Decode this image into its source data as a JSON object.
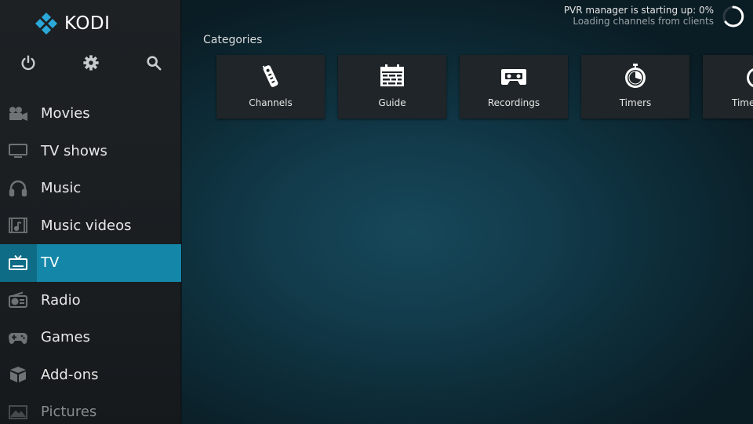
{
  "app": {
    "logo_text": "KODI"
  },
  "sidebar": {
    "top_buttons": [
      {
        "name": "power",
        "icon": "power-icon"
      },
      {
        "name": "settings",
        "icon": "gear-icon"
      },
      {
        "name": "search",
        "icon": "search-icon"
      }
    ],
    "items": [
      {
        "label": "Movies",
        "icon": "movie-camera-icon"
      },
      {
        "label": "TV shows",
        "icon": "monitor-icon"
      },
      {
        "label": "Music",
        "icon": "headphones-icon"
      },
      {
        "label": "Music videos",
        "icon": "music-video-icon"
      },
      {
        "label": "TV",
        "icon": "tv-icon",
        "active": true
      },
      {
        "label": "Radio",
        "icon": "radio-icon"
      },
      {
        "label": "Games",
        "icon": "gamepad-icon"
      },
      {
        "label": "Add-ons",
        "icon": "box-icon"
      },
      {
        "label": "Pictures",
        "icon": "picture-icon",
        "dim": true
      }
    ]
  },
  "status": {
    "line1": "PVR manager is starting up:  0%",
    "line2": "Loading channels from clients"
  },
  "main": {
    "categories_title": "Categories",
    "tiles": [
      {
        "label": "Channels",
        "icon": "remote-icon"
      },
      {
        "label": "Guide",
        "icon": "calendar-grid-icon"
      },
      {
        "label": "Recordings",
        "icon": "cassette-icon"
      },
      {
        "label": "Timers",
        "icon": "stopwatch-icon"
      },
      {
        "label": "Timer rules",
        "icon": "timer-rules-icon"
      }
    ]
  },
  "colors": {
    "accent": "#1487a9",
    "accent_dark": "#0f6c87",
    "sidebar_bg": "#1d2124",
    "tile_bg": "#1f2528"
  }
}
